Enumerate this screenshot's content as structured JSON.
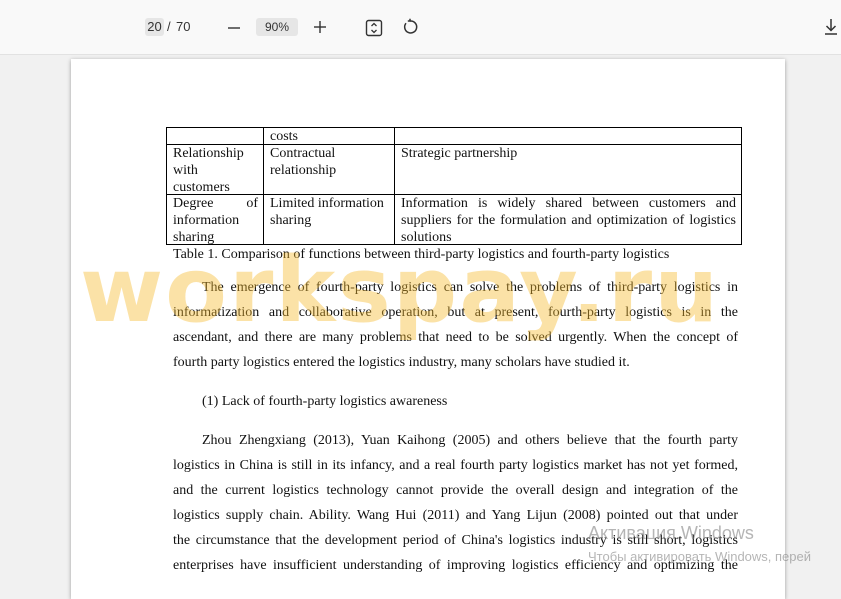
{
  "toolbar": {
    "current_page": "20",
    "page_separator": "/",
    "total_pages": "70",
    "zoom": "90%"
  },
  "table": {
    "row0": {
      "c1": "costs",
      "c2": ""
    },
    "row1": {
      "c0": [
        "Relationship",
        "with",
        "customers"
      ],
      "c1": [
        "Contractual",
        "relationship"
      ],
      "c2": "Strategic partnership"
    },
    "row2": {
      "c0": [
        "Degree of",
        "information",
        "sharing"
      ],
      "c1": [
        "Limited information",
        "sharing"
      ],
      "c2": [
        "Information is widely shared between customers and",
        "suppliers for the formulation and optimization of logistics",
        "solutions"
      ]
    },
    "caption": "Table 1. Comparison of functions between third-party logistics and fourth-party logistics"
  },
  "body": {
    "p1": [
      "The emergence of fourth-party logistics can solve the problems of third-party logistics in",
      "informatization and collaborative operation, but at present, fourth-party logistics is in the",
      "ascendant, and there are many problems that need to be solved urgently. When the concept of",
      "fourth party logistics entered the logistics industry, many scholars have studied it."
    ],
    "heading": "(1) Lack of fourth-party logistics awareness",
    "p2": [
      "Zhou Zhengxiang (2013), Yuan Kaihong (2005) and others believe that the fourth party",
      "logistics in China is still in its infancy, and a real fourth party logistics market has not yet formed,",
      "and the current logistics technology cannot provide the overall design and integration of the",
      "logistics supply chain. Ability. Wang Hui (2011) and Yang Lijun (2008) pointed out that under",
      "the circumstance that the development period of China's logistics industry is still short, logistics",
      "enterprises have insufficient understanding of improving logistics efficiency and optimizing the"
    ]
  },
  "watermark": "workspay.ru",
  "activation": {
    "title": "Активация Windows",
    "subtitle": "Чтобы активировать Windows, перей"
  }
}
